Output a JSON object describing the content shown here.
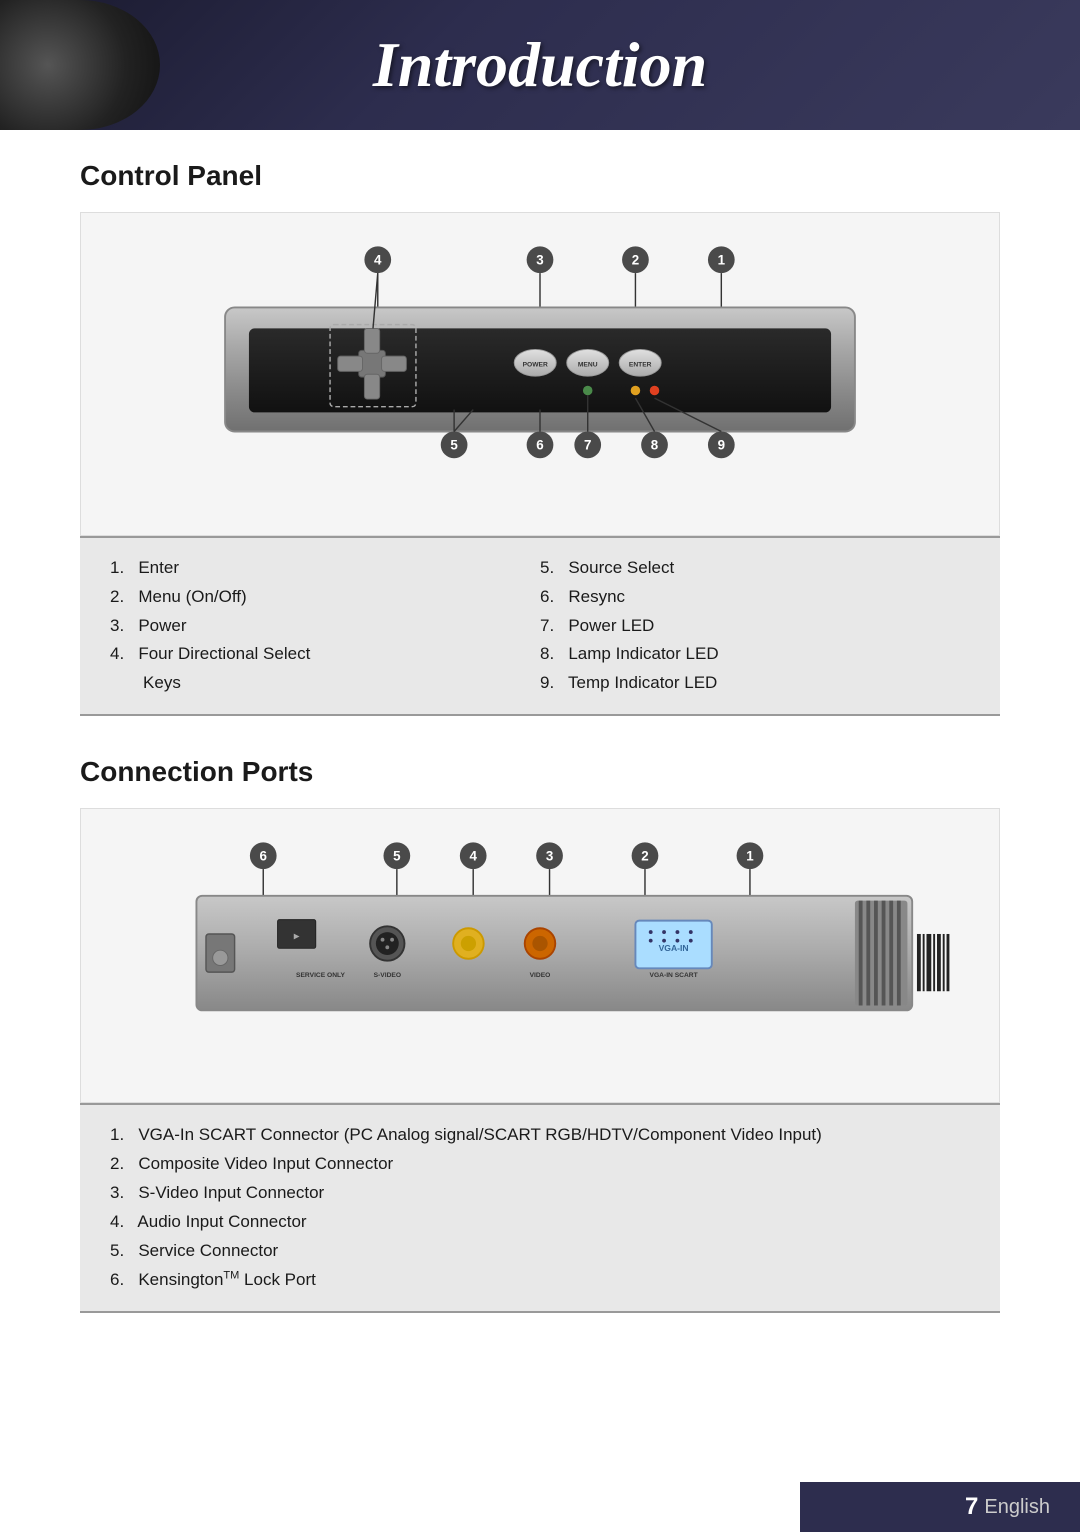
{
  "header": {
    "title": "Introduction"
  },
  "controlPanel": {
    "heading": "Control Panel",
    "items_left": [
      {
        "num": "1.",
        "text": "Enter"
      },
      {
        "num": "2.",
        "text": "Menu (On/Off)"
      },
      {
        "num": "3.",
        "text": "Power"
      },
      {
        "num": "4.",
        "text": "Four Directional Select Keys"
      }
    ],
    "items_right": [
      {
        "num": "5.",
        "text": "Source Select"
      },
      {
        "num": "6.",
        "text": "Resync"
      },
      {
        "num": "7.",
        "text": "Power LED"
      },
      {
        "num": "8.",
        "text": "Lamp Indicator LED"
      },
      {
        "num": "9.",
        "text": "Temp Indicator LED"
      }
    ]
  },
  "connectionPorts": {
    "heading": "Connection Ports",
    "items": [
      {
        "num": "1.",
        "text": "VGA-In SCART Connector (PC Analog signal/SCART RGB/HDTV/Component Video Input)"
      },
      {
        "num": "2.",
        "text": "Composite Video Input Connector"
      },
      {
        "num": "3.",
        "text": "S-Video Input Connector"
      },
      {
        "num": "4.",
        "text": "Audio Input Connector"
      },
      {
        "num": "5.",
        "text": "Service Connector"
      },
      {
        "num": "6.",
        "text": "Kensington™ Lock Port"
      }
    ]
  },
  "footer": {
    "page_number": "7",
    "language": "English"
  }
}
